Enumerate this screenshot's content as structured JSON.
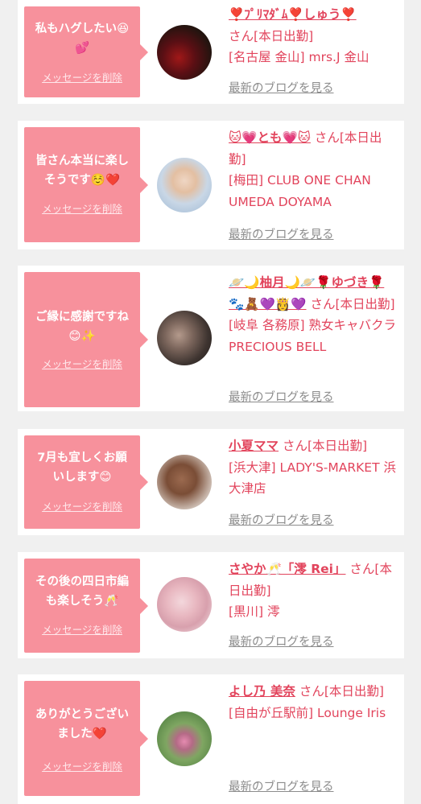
{
  "delete_label": "メッセージを削除",
  "blog_label": "最新のブログを見る",
  "san_suffix": "さん",
  "status": "[本日出勤]",
  "entries": [
    {
      "message": "私もハグしたい😆\n💕",
      "name": "❣️ﾌﾟﾘﾏﾀﾞﾑ❣️しゅう❣️",
      "area": "[名古屋 金山]",
      "shop": "mrs.J 金山"
    },
    {
      "message": "皆さん本当に楽し\nそうです☺️❤️",
      "name": "🐱💗とも💗🐱",
      "area": "[梅田]",
      "shop": "CLUB ONE CHAN UMEDA DOYAMA"
    },
    {
      "message": "ご縁に感謝ですね\n😊✨",
      "name": "🪐🌙柚月🌙🪐🌹ゆづき🌹🐾🧸💜👸💜",
      "area": "[岐阜 各務原]",
      "shop": "熟女キャバクラ PRECIOUS BELL"
    },
    {
      "message": "7月も宜しくお願\nいします😊",
      "name": "小夏ママ",
      "area": "[浜大津]",
      "shop": "LADY'S-MARKET 浜大津店"
    },
    {
      "message": "その後の四日市編\nも楽しそう🥂",
      "name": "さやか🥂「澪 Rei」",
      "area": "[黒川]",
      "shop": "澪"
    },
    {
      "message": "ありがとうござい\nました❤️",
      "name": "よし乃 美奈",
      "area": "[自由が丘駅前]",
      "shop": "Lounge Iris"
    }
  ]
}
